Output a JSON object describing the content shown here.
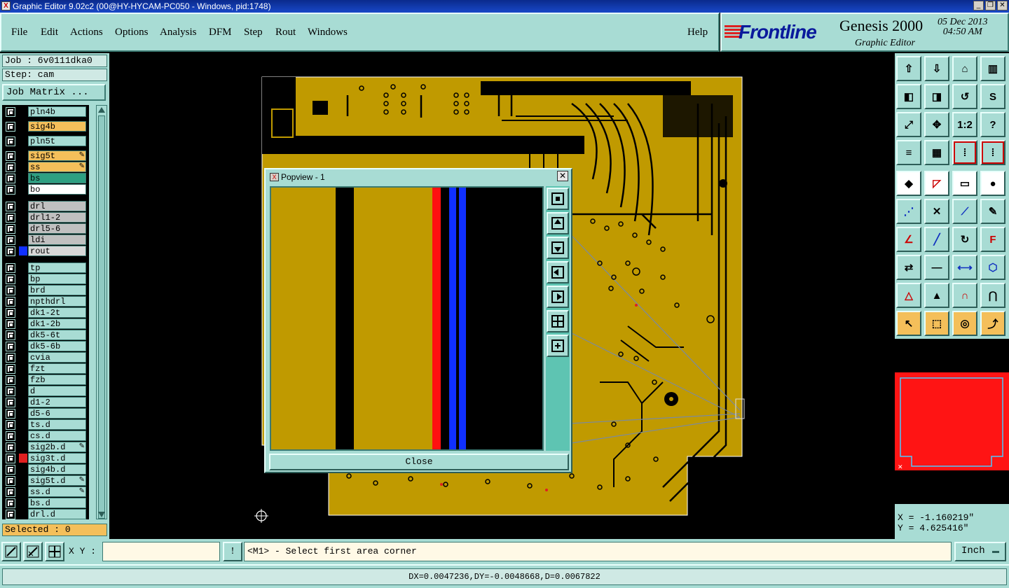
{
  "window": {
    "title": "Graphic Editor 9.02c2 (00@HY-HYCAM-PC050 - Windows, pid:1748)"
  },
  "menu": {
    "items": [
      "File",
      "Edit",
      "Actions",
      "Options",
      "Analysis",
      "DFM",
      "Step",
      "Rout",
      "Windows"
    ],
    "help": "Help"
  },
  "logo": {
    "brand": "Frontline",
    "product": "Genesis 2000",
    "subtitle": "Graphic Editor",
    "date": "05 Dec 2013",
    "time": "04:50 AM"
  },
  "job": {
    "label": "Job : 6v0111dka0",
    "step": "Step: cam",
    "matrix_button": "Job Matrix ..."
  },
  "layers": [
    {
      "name": "pln4b",
      "bg": "#a8dcd4",
      "swatch": "#000",
      "edit": false
    },
    {
      "name": "sig4b",
      "bg": "#f4bf5a",
      "swatch": "#000",
      "edit": false
    },
    {
      "name": "pln5t",
      "bg": "#a8dcd4",
      "swatch": "#000",
      "edit": false
    },
    {
      "name": "sig5t",
      "bg": "#f4bf5a",
      "swatch": "#000",
      "edit": true
    },
    {
      "name": "ss",
      "bg": "#f4bf5a",
      "swatch": "#000",
      "edit": true
    },
    {
      "name": "bs",
      "bg": "#2ea082",
      "swatch": "#000",
      "edit": false
    },
    {
      "name": "bo",
      "bg": "#ffffff",
      "swatch": "#000",
      "edit": false
    },
    {
      "name": "drl",
      "bg": "#c0c0c0",
      "swatch": "#000",
      "edit": false
    },
    {
      "name": "drl1-2",
      "bg": "#c0c0c0",
      "swatch": "#000",
      "edit": false
    },
    {
      "name": "drl5-6",
      "bg": "#c0c0c0",
      "swatch": "#000",
      "edit": false
    },
    {
      "name": "ldi",
      "bg": "#c0c0c0",
      "swatch": "#000",
      "edit": false
    },
    {
      "name": "rout",
      "bg": "#d8d8d8",
      "swatch": "#1030ff",
      "edit": false
    },
    {
      "name": "tp",
      "bg": "#a8dcd4",
      "swatch": "#000",
      "edit": false
    },
    {
      "name": "bp",
      "bg": "#a8dcd4",
      "swatch": "#000",
      "edit": false
    },
    {
      "name": "brd",
      "bg": "#a8dcd4",
      "swatch": "#000",
      "edit": false
    },
    {
      "name": "npthdrl",
      "bg": "#a8dcd4",
      "swatch": "#000",
      "edit": false
    },
    {
      "name": "dk1-2t",
      "bg": "#a8dcd4",
      "swatch": "#000",
      "edit": false
    },
    {
      "name": "dk1-2b",
      "bg": "#a8dcd4",
      "swatch": "#000",
      "edit": false
    },
    {
      "name": "dk5-6t",
      "bg": "#a8dcd4",
      "swatch": "#000",
      "edit": false
    },
    {
      "name": "dk5-6b",
      "bg": "#a8dcd4",
      "swatch": "#000",
      "edit": false
    },
    {
      "name": "cvia",
      "bg": "#a8dcd4",
      "swatch": "#000",
      "edit": false
    },
    {
      "name": "fzt",
      "bg": "#a8dcd4",
      "swatch": "#000",
      "edit": false
    },
    {
      "name": "fzb",
      "bg": "#a8dcd4",
      "swatch": "#000",
      "edit": false
    },
    {
      "name": "d",
      "bg": "#a8dcd4",
      "swatch": "#000",
      "edit": false
    },
    {
      "name": "d1-2",
      "bg": "#a8dcd4",
      "swatch": "#000",
      "edit": false
    },
    {
      "name": "d5-6",
      "bg": "#a8dcd4",
      "swatch": "#000",
      "edit": false
    },
    {
      "name": "ts.d",
      "bg": "#a8dcd4",
      "swatch": "#000",
      "edit": false
    },
    {
      "name": "cs.d",
      "bg": "#a8dcd4",
      "swatch": "#000",
      "edit": false
    },
    {
      "name": "sig2b.d",
      "bg": "#a8dcd4",
      "swatch": "#000",
      "edit": true
    },
    {
      "name": "sig3t.d",
      "bg": "#a8dcd4",
      "swatch": "#e02020",
      "edit": false
    },
    {
      "name": "sig4b.d",
      "bg": "#a8dcd4",
      "swatch": "#000",
      "edit": false
    },
    {
      "name": "sig5t.d",
      "bg": "#a8dcd4",
      "swatch": "#000",
      "edit": true
    },
    {
      "name": "ss.d",
      "bg": "#a8dcd4",
      "swatch": "#000",
      "edit": true
    },
    {
      "name": "bs.d",
      "bg": "#a8dcd4",
      "swatch": "#000",
      "edit": false
    },
    {
      "name": "drl.d",
      "bg": "#a8dcd4",
      "swatch": "#000",
      "edit": false
    }
  ],
  "selected": "Selected : 0",
  "popview": {
    "title": "Popview - 1",
    "close_label": "Close"
  },
  "coords": {
    "x": "X = -1.160219\"",
    "y": "Y = 4.625416\""
  },
  "bottom": {
    "xy_label": "X Y :",
    "xy_value": "",
    "prompt": "<M1> - Select first area corner",
    "units": "Inch",
    "excl": "!"
  },
  "status": "DX=0.0047236,DY=-0.0048668,D=0.0067822",
  "colors": {
    "copper": "#c09a00",
    "panel": "#a8dcd4",
    "accent_red": "#e02020",
    "accent_blue": "#1030ff"
  }
}
